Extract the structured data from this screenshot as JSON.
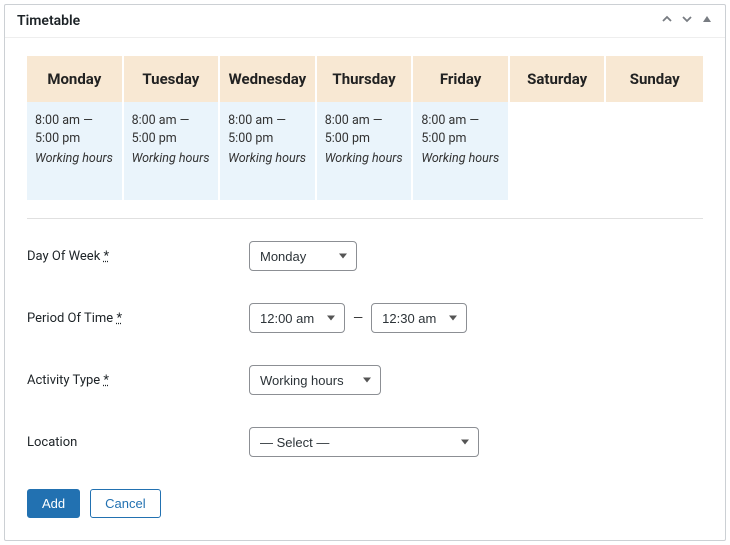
{
  "panel": {
    "title": "Timetable"
  },
  "days": [
    {
      "name": "Monday",
      "slot": {
        "time": "8:00 am — 5:00 pm",
        "activity": "Working hours"
      }
    },
    {
      "name": "Tuesday",
      "slot": {
        "time": "8:00 am — 5:00 pm",
        "activity": "Working hours"
      }
    },
    {
      "name": "Wednesday",
      "slot": {
        "time": "8:00 am — 5:00 pm",
        "activity": "Working hours"
      }
    },
    {
      "name": "Thursday",
      "slot": {
        "time": "8:00 am — 5:00 pm",
        "activity": "Working hours"
      }
    },
    {
      "name": "Friday",
      "slot": {
        "time": "8:00 am — 5:00 pm",
        "activity": "Working hours"
      }
    },
    {
      "name": "Saturday",
      "slot": null
    },
    {
      "name": "Sunday",
      "slot": null
    }
  ],
  "form": {
    "day_of_week": {
      "label": "Day Of Week",
      "req": "*",
      "value": "Monday"
    },
    "period": {
      "label": "Period Of Time",
      "req": "*",
      "start": "12:00 am",
      "end": "12:30 am",
      "dash": "—"
    },
    "activity_type": {
      "label": "Activity Type",
      "req": "*",
      "value": "Working hours"
    },
    "location": {
      "label": "Location",
      "value": "— Select —"
    }
  },
  "buttons": {
    "add": "Add",
    "cancel": "Cancel"
  }
}
